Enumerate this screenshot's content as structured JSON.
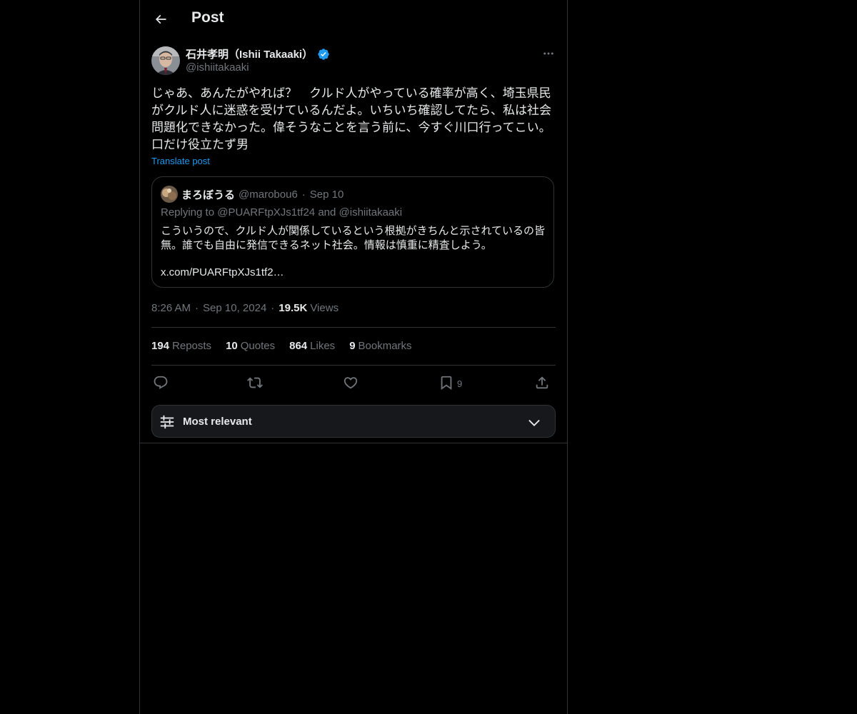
{
  "header": {
    "title": "Post"
  },
  "post": {
    "author_name": "石井孝明（Ishii Takaaki）",
    "author_handle": "@ishiitakaaki",
    "text": "じゃあ、あんたがやれば？　クルド人がやっている確率が高く、埼玉県民がクルド人に迷惑を受けているんだよ。いちいち確認してたら、私は社会問題化できなかった。偉そうなことを言う前に、今すぐ川口行ってこい。口だけ役立たず男",
    "translate_label": "Translate post",
    "time": "8:26 AM",
    "date": "Sep 10, 2024",
    "views_count": "19.5K",
    "views_label": "Views"
  },
  "quote": {
    "author_name": "まろぼうる",
    "author_handle": "@marobou6",
    "date": "Sep 10",
    "replying": "Replying to @PUARFtpXJs1tf24 and @ishiitakaaki",
    "text": "こういうので、クルド人が関係しているという根拠がきちんと示されているの皆無。誰でも自由に発信できるネット社会。情報は慎重に精査しよう。",
    "link": "x.com/PUARFtpXJs1tf2…"
  },
  "stats": {
    "reposts_count": "194",
    "reposts_label": "Reposts",
    "quotes_count": "10",
    "quotes_label": "Quotes",
    "likes_count": "864",
    "likes_label": "Likes",
    "bookmarks_count": "9",
    "bookmarks_label": "Bookmarks"
  },
  "actions": {
    "bookmark_count": "9"
  },
  "sort": {
    "label": "Most relevant"
  },
  "icons": {
    "back": "back-arrow-icon",
    "verified": "verified-badge-icon",
    "more": "more-options-icon",
    "reply": "reply-icon",
    "repost": "repost-icon",
    "like": "heart-icon",
    "bookmark": "bookmark-icon",
    "share": "share-icon",
    "filter": "sliders-icon",
    "chevron": "chevron-down-icon"
  },
  "colors": {
    "background": "#000000",
    "accent": "#1d9bf0",
    "text_primary": "#e7e9ea",
    "text_secondary": "#71767b",
    "border": "#2f3336"
  }
}
